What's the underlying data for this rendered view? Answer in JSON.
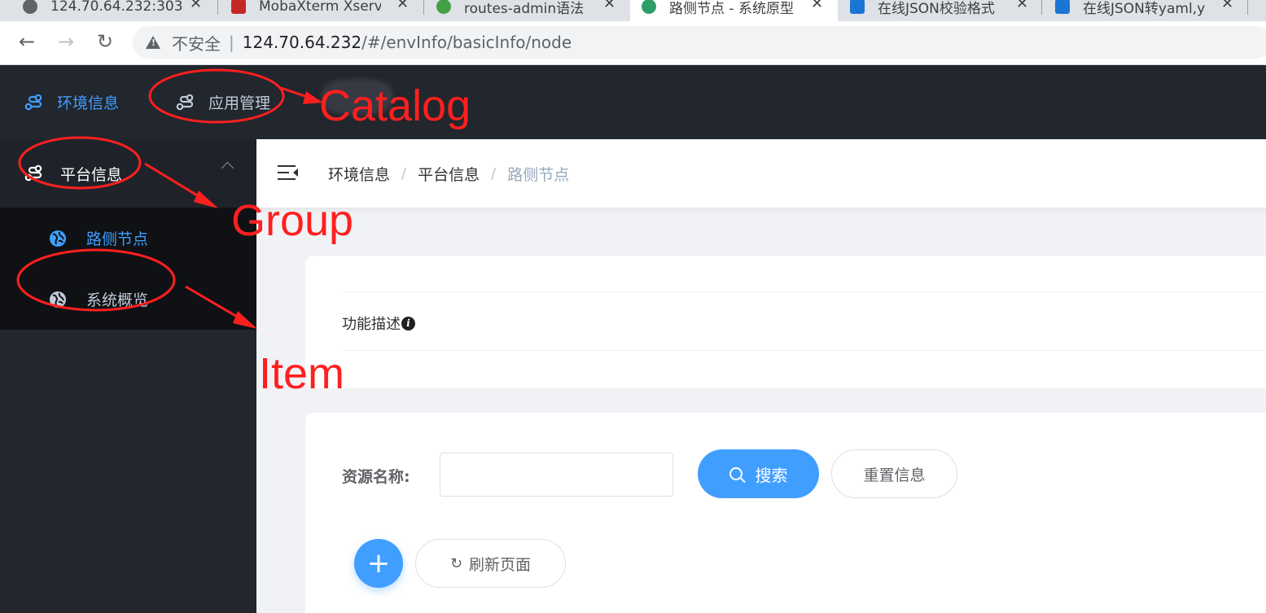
{
  "browser": {
    "tabs": [
      {
        "title": "124.70.64.232:303",
        "favicon_color": "#5f6368",
        "active": false
      },
      {
        "title": "MobaXterm Xserv",
        "favicon_color": "#c62828",
        "active": false
      },
      {
        "title": "routes-admin语法",
        "favicon_color": "#43a047",
        "active": false
      },
      {
        "title": "路侧节点 - 系统原型",
        "favicon_color": "#2e9d6a",
        "active": true
      },
      {
        "title": "在线JSON校验格式",
        "favicon_color": "#1976d2",
        "active": false
      },
      {
        "title": "在线JSON转yaml,y",
        "favicon_color": "#1976d2",
        "active": false
      }
    ],
    "close_glyph": "✕",
    "nav": {
      "back": "←",
      "forward": "→",
      "reload": "↻"
    },
    "address": {
      "security_label": "不安全",
      "separator": "|",
      "host": "124.70.64.232",
      "path": "/#/envInfo/basicInfo/node"
    }
  },
  "app": {
    "catalog": [
      {
        "label": "环境信息",
        "active": true,
        "icon": "route-icon"
      },
      {
        "label": "应用管理",
        "active": false,
        "icon": "route-icon"
      }
    ],
    "sidebar": {
      "group": {
        "label": "平台信息",
        "icon": "route-icon",
        "expanded": true
      },
      "items": [
        {
          "label": "路侧节点",
          "active": true,
          "icon": "globe-icon"
        },
        {
          "label": "系统概览",
          "active": false,
          "icon": "globe-icon"
        }
      ]
    },
    "breadcrumb": [
      "环境信息",
      "平台信息",
      "路侧节点"
    ],
    "breadcrumb_separator": "/",
    "description_label": "功能描述",
    "info_glyph": "i",
    "search_form": {
      "label": "资源名称:",
      "input_value": "",
      "search_button": "搜索",
      "reset_button": "重置信息"
    },
    "actions": {
      "add_glyph": "+",
      "refresh_glyph": "↻",
      "refresh_button": "刷新页面"
    }
  },
  "annotations": {
    "labels": [
      "Catalog",
      "Group",
      "Item"
    ],
    "color": "#ff1f1f"
  },
  "colors": {
    "accent": "#409eff",
    "menu_active": "#409eff",
    "sidebar_bg": "#22262d",
    "menu_text": "#bfcbd9",
    "breadcrumb_current": "#97a8be"
  }
}
